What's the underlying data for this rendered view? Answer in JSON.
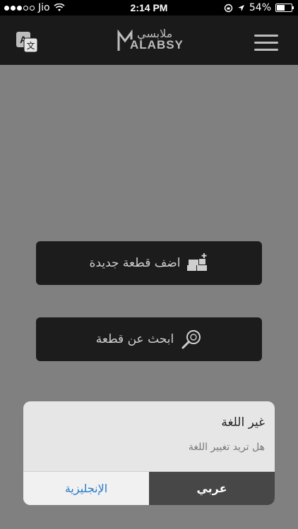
{
  "status_bar": {
    "carrier": "Jio",
    "time": "2:14 PM",
    "battery": "54%",
    "battery_level": 0.54
  },
  "nav": {
    "logo_latin": "ALABSY",
    "logo_arabic": "ملابسي"
  },
  "actions": {
    "add_label": "اضف قطعة جديدة",
    "search_label": "ابحث عن قطعة"
  },
  "alert": {
    "title": "غير اللغة",
    "message": "هل تريد تغيير اللغة",
    "english_button": "الإنجليزية",
    "arabic_button": "عربي"
  },
  "colors": {
    "background": "#808080",
    "nav": "#1a1a1a",
    "button": "#1c1c1c",
    "link_blue": "#2a79c9"
  },
  "icons": [
    "translate-icon",
    "menu-icon",
    "add-clothes-icon",
    "search-clothes-icon",
    "wifi-icon",
    "location-icon",
    "battery-icon"
  ]
}
